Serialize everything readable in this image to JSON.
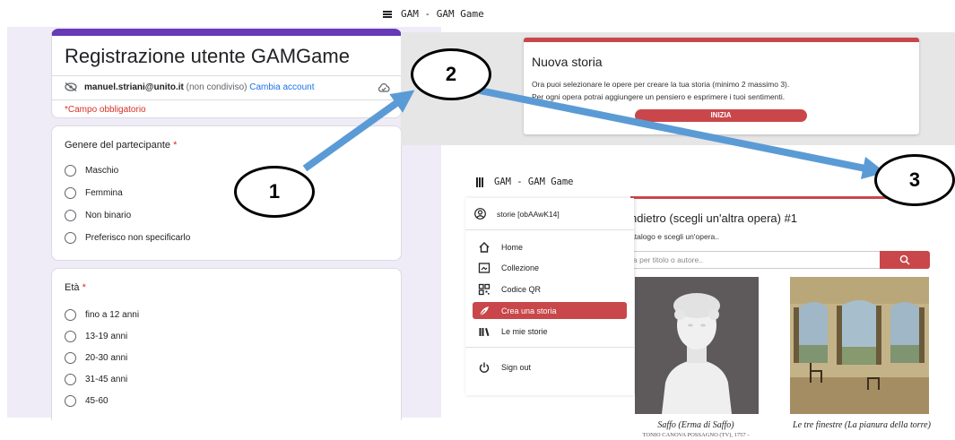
{
  "form": {
    "title": "Registrazione utente GAMGame",
    "account_email": "manuel.striani@unito.it",
    "account_note": "(non condiviso)",
    "switch_account": "Cambia account",
    "required_note": "*Campo obbligatorio",
    "questions": [
      {
        "title": "Genere del partecipante",
        "required_mark": "*",
        "options": [
          "Maschio",
          "Femmina",
          "Non binario",
          "Preferisco non specificarlo"
        ]
      },
      {
        "title": "Età",
        "required_mark": "*",
        "options": [
          "fino a 12 anni",
          "13-19 anni",
          "20-30 anni",
          "31-45 anni",
          "45-60"
        ]
      }
    ]
  },
  "story": {
    "app_title": "GAM - GAM Game",
    "card_title": "Nuova storia",
    "text_line1": "Ora puoi selezionare le opere per creare la tua storia (minimo 2 massimo 3).",
    "text_line2": "Per ogni opera potrai aggiungere un pensiero e esprimere i tuoi sentimenti.",
    "start_button": "INIZIA"
  },
  "catalog": {
    "app_title": "GAM - GAM Game",
    "user_label": "storie [obAAwK14]",
    "menu": [
      {
        "label": "Home",
        "icon": "home-icon"
      },
      {
        "label": "Collezione",
        "icon": "collection-icon"
      },
      {
        "label": "Codice QR",
        "icon": "qr-code-icon"
      },
      {
        "label": "Crea una storia",
        "icon": "feather-icon",
        "active": true
      },
      {
        "label": "Le mie storie",
        "icon": "library-icon"
      },
      {
        "label": "Sign out",
        "icon": "power-icon"
      }
    ],
    "heading": "ndietro (scegli un'altra opera) #1",
    "subheading": "atalogo e scegli un'opera..",
    "search_placeholder": "a per titolo o autore..",
    "artworks": [
      {
        "title": "Saffo (Erma di Saffo)",
        "subtitle": "TONIO CANOVA POSSAGNO (TV), 1757 -"
      },
      {
        "title": "Le tre finestre (La pianura della torre)"
      }
    ]
  },
  "badges": [
    "1",
    "2",
    "3"
  ],
  "colors": {
    "form_accent": "#673ab7",
    "brand_red": "#c9474a",
    "arrow_blue": "#5b9bd5",
    "required_red": "#d93025",
    "link_blue": "#1a73e8"
  }
}
